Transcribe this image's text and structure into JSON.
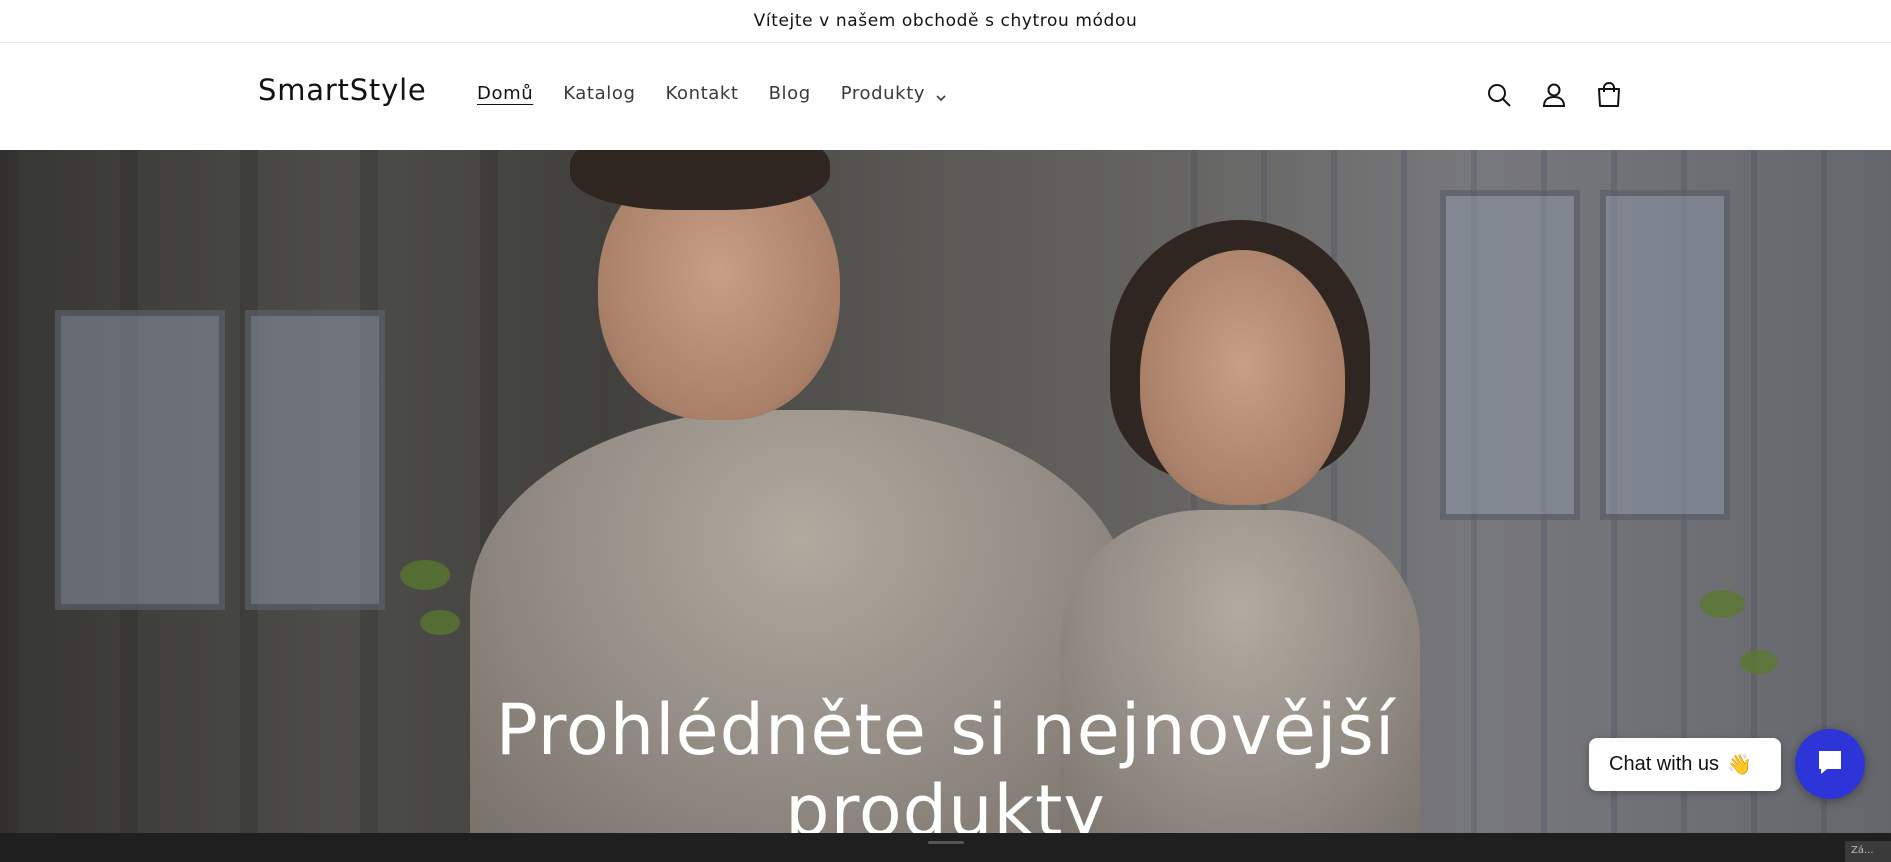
{
  "announcement": {
    "text": "Vítejte v našem obchodě s chytrou módou"
  },
  "header": {
    "logo": "SmartStyle",
    "nav": [
      {
        "label": "Domů",
        "active": true
      },
      {
        "label": "Katalog",
        "active": false
      },
      {
        "label": "Kontakt",
        "active": false
      },
      {
        "label": "Blog",
        "active": false
      },
      {
        "label": "Produkty",
        "active": false,
        "has_dropdown": true
      }
    ],
    "icons": [
      "search-icon",
      "account-icon",
      "cart-icon"
    ]
  },
  "hero": {
    "title_line1": "Prohlédněte si nejnovější",
    "title_line2": "produkty"
  },
  "chat": {
    "bubble_text": "Chat with us",
    "emoji": "👋",
    "button_color": "#2d35d8"
  },
  "corner_badge": "Zá..."
}
